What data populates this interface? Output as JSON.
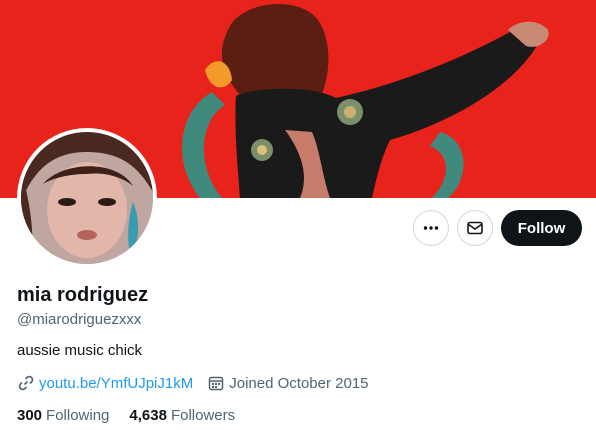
{
  "profile": {
    "display_name": "mia rodriguez",
    "handle": "@miarodriguezxxx",
    "bio": "aussie music chick",
    "website": "youtu.be/YmfUJpiJ1kM",
    "joined": "Joined October 2015",
    "following_count": "300",
    "following_label": "Following",
    "followers_count": "4,638",
    "followers_label": "Followers"
  },
  "actions": {
    "more_icon": "more-horizontal-icon",
    "message_icon": "envelope-icon",
    "follow_label": "Follow"
  },
  "icons": {
    "link": "link-icon",
    "calendar": "calendar-icon"
  },
  "colors": {
    "banner_red": "#e8231b",
    "link_blue": "#1d9bf0",
    "secondary_text": "#536471",
    "primary_text": "#0f1419",
    "follow_button_bg": "#0f1419"
  }
}
